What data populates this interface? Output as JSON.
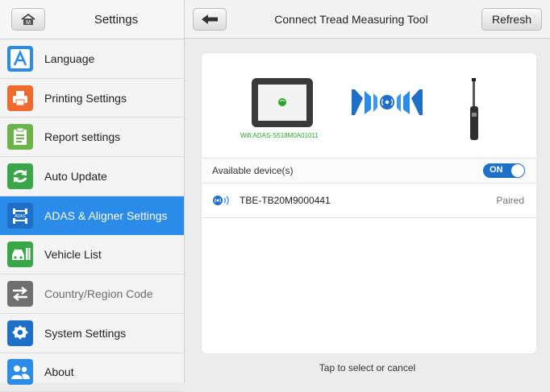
{
  "sidebar": {
    "title": "Settings",
    "items": [
      {
        "label": "Language",
        "icon": "language-icon",
        "color": "#2a8be8"
      },
      {
        "label": "Printing Settings",
        "icon": "printer-icon",
        "color": "#ef6a2e"
      },
      {
        "label": "Report settings",
        "icon": "report-icon",
        "color": "#6ab44a"
      },
      {
        "label": "Auto Update",
        "icon": "update-icon",
        "color": "#3aa64a"
      },
      {
        "label": "ADAS & Aligner Settings",
        "icon": "adas-icon",
        "color": "#2a8be8"
      },
      {
        "label": "Vehicle List",
        "icon": "vehicle-list-icon",
        "color": "#3aa64a"
      },
      {
        "label": "Country/Region Code",
        "icon": "country-region-icon",
        "color": "#6f6f6f"
      },
      {
        "label": "System Settings",
        "icon": "gear-icon",
        "color": "#1e6fc7"
      },
      {
        "label": "About",
        "icon": "about-icon",
        "color": "#2a8be8"
      }
    ],
    "active_index": 4
  },
  "header": {
    "title": "Connect Tread Measuring Tool",
    "refresh_label": "Refresh"
  },
  "illustration": {
    "wifi_label": "Wifi:ADAS-S518M0A01011"
  },
  "devices": {
    "available_label": "Available device(s)",
    "toggle_label": "ON",
    "list": [
      {
        "name": "TBE-TB20M9000441",
        "status": "Paired"
      }
    ]
  },
  "footer": {
    "hint": "Tap to select or cancel"
  },
  "colors": {
    "accent": "#2a8be8",
    "wifi_green": "#2aa52a"
  }
}
